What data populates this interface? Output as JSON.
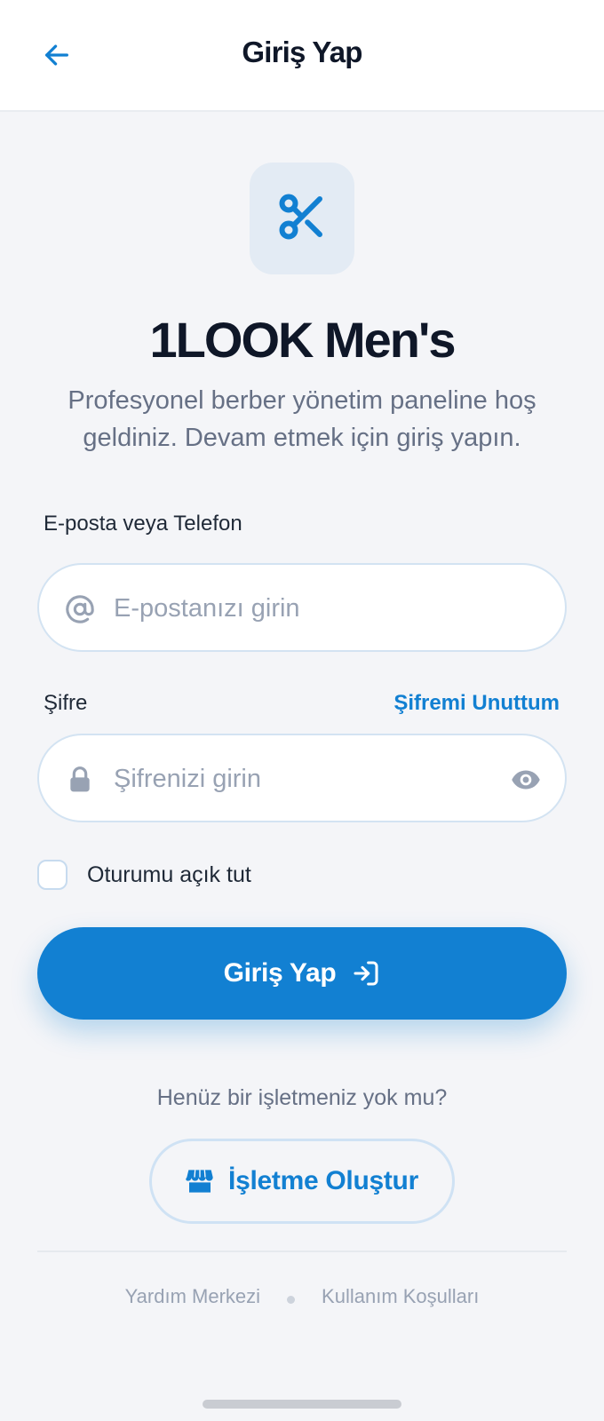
{
  "header": {
    "title": "Giriş Yap",
    "back_icon": "arrow-left-icon"
  },
  "brand": {
    "logo_icon": "scissors-icon",
    "name": "1LOOK Men's",
    "subtitle": "Profesyonel berber yönetim paneline hoş geldiniz. Devam etmek için giriş yapın."
  },
  "form": {
    "email": {
      "label": "E-posta veya Telefon",
      "placeholder": "E-postanızı girin",
      "value": "",
      "icon": "at-sign-icon"
    },
    "password": {
      "label": "Şifre",
      "forgot_link": "Şifremi Unuttum",
      "placeholder": "Şifrenizi girin",
      "value": "",
      "icon": "lock-icon",
      "toggle_icon": "eye-icon"
    },
    "remember": {
      "label": "Oturumu açık tut",
      "checked": false
    },
    "submit": {
      "label": "Giriş Yap",
      "icon": "login-icon"
    }
  },
  "signup": {
    "prompt": "Henüz bir işletmeniz yok mu?",
    "button_label": "İşletme Oluştur",
    "icon": "store-icon"
  },
  "footer": {
    "help": "Yardım Merkezi",
    "terms": "Kullanım Koşulları"
  },
  "colors": {
    "accent": "#1280d2",
    "background": "#f4f5f8",
    "text_primary": "#0f1728",
    "text_muted": "#667085"
  }
}
